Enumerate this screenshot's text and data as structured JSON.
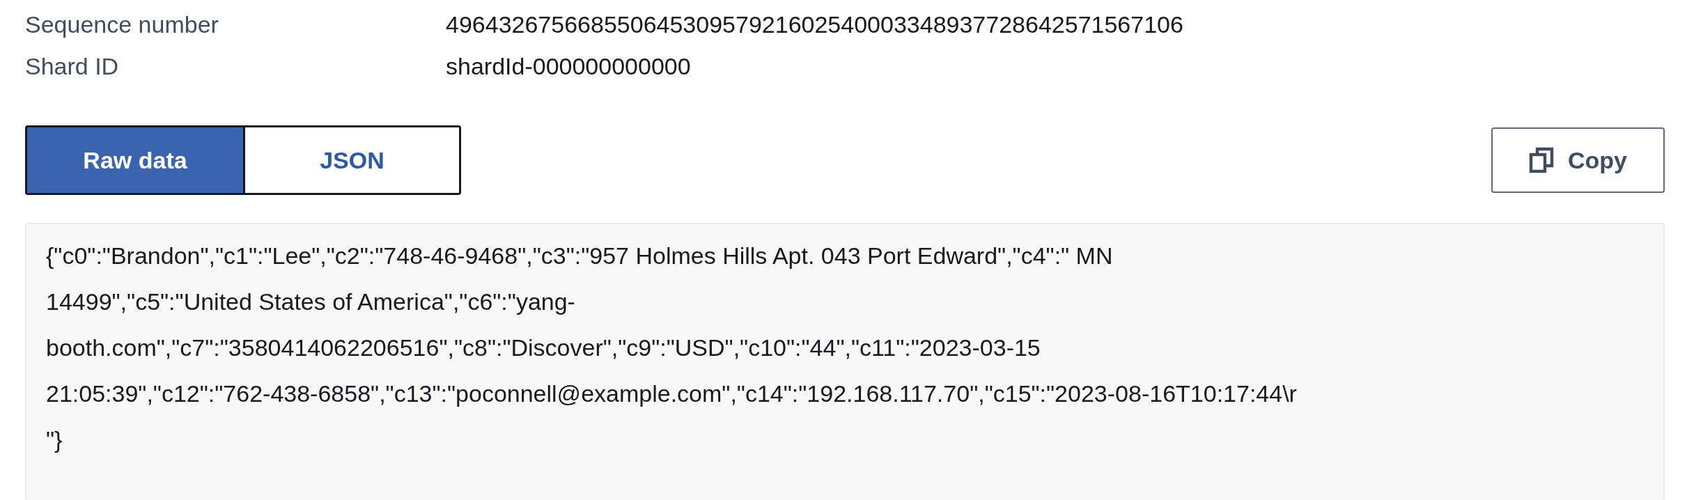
{
  "details": [
    {
      "label": "Sequence number",
      "value": "49643267566855064530957921602540003348937728642571567106"
    },
    {
      "label": "Shard ID",
      "value": "shardId-000000000000"
    }
  ],
  "view_tabs": [
    {
      "label": "Raw data",
      "selected": true
    },
    {
      "label": "JSON",
      "selected": false
    }
  ],
  "copy_button": {
    "label": "Copy"
  },
  "record_lines": [
    "{\"c0\":\"Brandon\",\"c1\":\"Lee\",\"c2\":\"748-46-9468\",\"c3\":\"957 Holmes Hills Apt. 043 Port Edward\",\"c4\":\" MN",
    "14499\",\"c5\":\"United States of America\",\"c6\":\"yang-",
    "booth.com\",\"c7\":\"3580414062206516\",\"c8\":\"Discover\",\"c9\":\"USD\",\"c10\":\"44\",\"c11\":\"2023-03-15",
    "21:05:39\",\"c12\":\"762-438-6858\",\"c13\":\"poconnell@example.com\",\"c14\":\"192.168.117.70\",\"c15\":\"2023-08-16T10:17:44\\r",
    "\"}"
  ]
}
